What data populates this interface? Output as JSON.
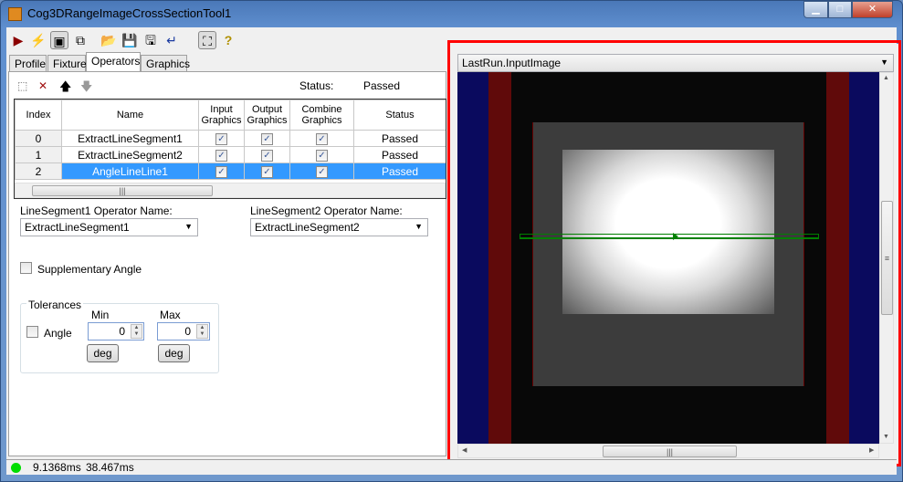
{
  "window": {
    "title": "Cog3DRangeImageCrossSectionTool1",
    "minimize": "▁",
    "maximize": "□",
    "close": "✕"
  },
  "toolbar": {
    "icons": [
      "run-icon",
      "electric-icon",
      "show-all-icon",
      "float-icon",
      "open-icon",
      "save-icon",
      "save-as-icon",
      "reset-icon",
      "select-icon",
      "help-icon"
    ],
    "glyphs": [
      "▶",
      "⚡",
      "▣",
      "⧉",
      "📂",
      "💾",
      "🖫",
      "↵",
      "⛶",
      "?"
    ]
  },
  "tabs": [
    {
      "label": "Profile"
    },
    {
      "label": "Fixture"
    },
    {
      "label": "Operators",
      "active": true
    },
    {
      "label": "Graphics"
    }
  ],
  "operators": {
    "tools": {
      "add": "⬚",
      "delete": "✕",
      "up": "🡅",
      "down": "🡇"
    },
    "status_label": "Status:",
    "status_value": "Passed",
    "columns": [
      "Index",
      "Name",
      "Input Graphics",
      "Output Graphics",
      "Combine Graphics",
      "Status"
    ],
    "rows": [
      {
        "index": "0",
        "name": "ExtractLineSegment1",
        "input": true,
        "output": true,
        "combine": true,
        "status": "Passed"
      },
      {
        "index": "1",
        "name": "ExtractLineSegment2",
        "input": true,
        "output": true,
        "combine": true,
        "status": "Passed"
      },
      {
        "index": "2",
        "name": "AngleLineLine1",
        "input": true,
        "output": true,
        "combine": true,
        "status": "Passed",
        "selected": true
      }
    ],
    "check": "✓",
    "seg1_label": "LineSegment1 Operator Name:",
    "seg1_value": "ExtractLineSegment1",
    "seg2_label": "LineSegment2 Operator Name:",
    "seg2_value": "ExtractLineSegment2",
    "supplementary_label": "Supplementary Angle",
    "supplementary_checked": false,
    "tolerances": {
      "title": "Tolerances",
      "angle_label": "Angle",
      "angle_checked": false,
      "min_label": "Min",
      "max_label": "Max",
      "min_value": "0",
      "max_value": "0",
      "min_unit": "deg",
      "max_unit": "deg"
    }
  },
  "image_panel": {
    "selector": "LastRun.InputImage"
  },
  "statusbar": {
    "time1": "9.1368ms",
    "time2": "38.467ms",
    "status_color": "#00dd00"
  },
  "colors": {
    "highlight": "#ff0000",
    "selection": "#3399ff",
    "graphic": "#008000"
  }
}
